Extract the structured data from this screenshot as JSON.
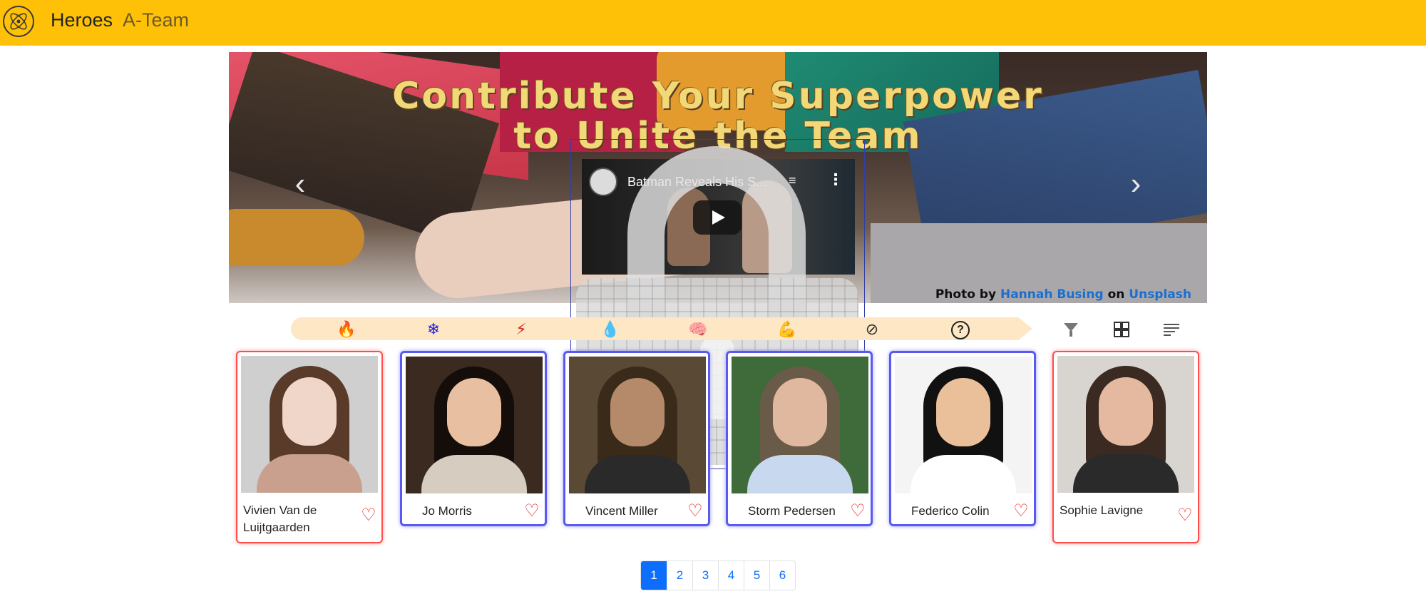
{
  "navbar": {
    "brand": "Heroes",
    "link": "A-Team",
    "logo_icon": "atom-circle-icon"
  },
  "banner": {
    "title_line1": "Contribute Your Superpower",
    "title_line2": "to Unite the Team",
    "credit_prefix": "Photo by ",
    "credit_author": "Hannah Busing",
    "credit_middle": " on ",
    "credit_site": "Unsplash",
    "prev_icon": "chevron-left-icon",
    "next_icon": "chevron-right-icon"
  },
  "video": {
    "title": "Batman Reveals His S..."
  },
  "powers": [
    {
      "icon": "fire-icon",
      "glyph": "🔥",
      "color": "#e0201e"
    },
    {
      "icon": "snowflake-icon",
      "glyph": "❄",
      "color": "#1e1ed6"
    },
    {
      "icon": "lightning-icon",
      "glyph": "⚡",
      "color": "#e0201e"
    },
    {
      "icon": "water-drop-icon",
      "glyph": "💧",
      "color": "#4a55b8"
    },
    {
      "icon": "mind-icon",
      "glyph": "🧠",
      "color": "#e0201e"
    },
    {
      "icon": "strength-icon",
      "glyph": "💪",
      "color": "#c9a86a"
    },
    {
      "icon": "invisible-eye-icon",
      "glyph": "⊘",
      "color": "#333333"
    },
    {
      "icon": "question-icon",
      "glyph": "?",
      "color": "#222222"
    }
  ],
  "toolbar": {
    "filter_icon": "filter-icon",
    "grid_icon": "grid-view-icon",
    "list_icon": "list-view-icon"
  },
  "heroes": [
    {
      "name": "Vivien Van de Luijtgaarden",
      "border": "red",
      "favorite_icon": "heart-outline-icon"
    },
    {
      "name": "Jo Morris",
      "border": "blue",
      "favorite_icon": "heart-outline-icon"
    },
    {
      "name": "Vincent Miller",
      "border": "blue",
      "favorite_icon": "heart-outline-icon"
    },
    {
      "name": "Storm Pedersen",
      "border": "blue",
      "favorite_icon": "heart-outline-icon"
    },
    {
      "name": "Federico Colin",
      "border": "blue",
      "favorite_icon": "heart-outline-icon"
    },
    {
      "name": "Sophie Lavigne",
      "border": "red",
      "favorite_icon": "heart-outline-icon"
    }
  ],
  "pagination": {
    "pages": [
      "1",
      "2",
      "3",
      "4",
      "5",
      "6"
    ],
    "active": "1"
  },
  "colors": {
    "navbar": "#ffc107",
    "accent_red": "#ff4d4d",
    "accent_blue": "#5a5af0",
    "pagination_active": "#0d6efd"
  }
}
